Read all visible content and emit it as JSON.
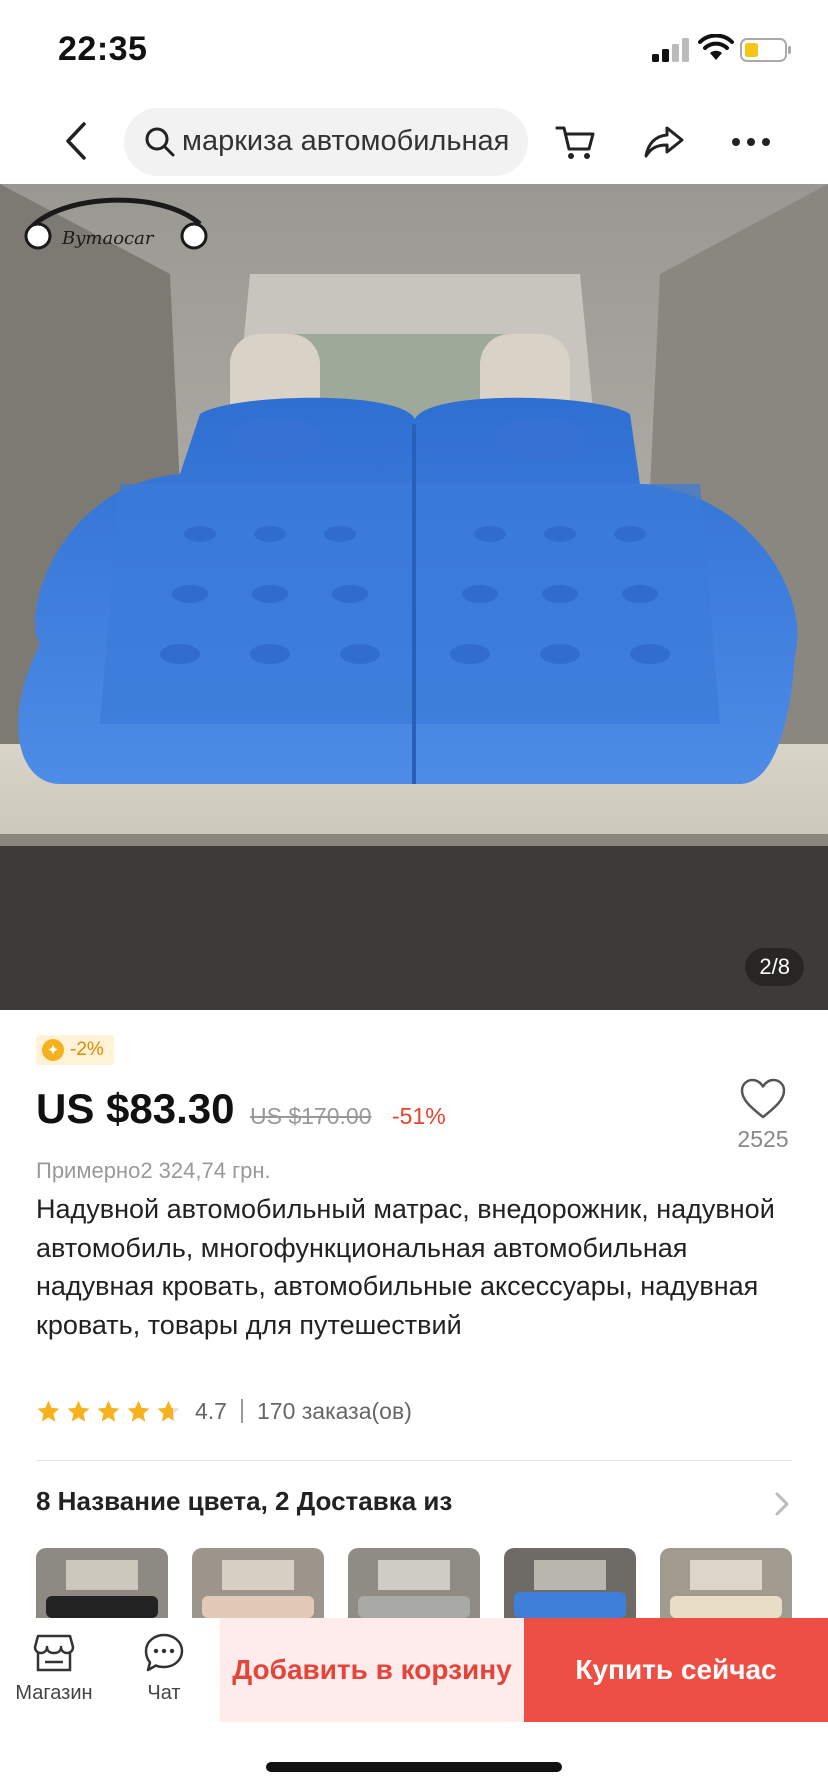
{
  "status": {
    "time": "22:35"
  },
  "search": {
    "query": "маркиза автомобильная"
  },
  "nav": {
    "icons": [
      "back-icon",
      "search-icon",
      "cart-icon",
      "share-icon",
      "more-icon"
    ]
  },
  "gallery": {
    "counter": "2/8",
    "logo_text": "Bymaocar"
  },
  "coins": {
    "label": "-2%"
  },
  "price": {
    "current": "US $83.30",
    "original": "US $170.00",
    "discount": "-51%",
    "approx": "Примерно2 324,74 грн."
  },
  "wishlist": {
    "count": "2525"
  },
  "product": {
    "title": "Надувной автомобильный матрас, внедорожник, надувной автомобиль, многофункциональная автомобильная надувная кровать, автомобильные аксессуары, надувная кровать, товары для путешествий",
    "rating": "4.7",
    "rating_value": 4.7,
    "orders": "170 заказа(ов)"
  },
  "variants": {
    "title": "8 Название цвета, 2 Доставка из"
  },
  "bottom_bar": {
    "store_label": "Магазин",
    "chat_label": "Чат",
    "add_to_cart": "Добавить в корзину",
    "buy_now": "Купить сейчас"
  },
  "colors": {
    "accent": "#ee4f44",
    "accent_light": "#fdeceb",
    "star": "#f6b21c",
    "mattress": "#3f7fd9"
  }
}
